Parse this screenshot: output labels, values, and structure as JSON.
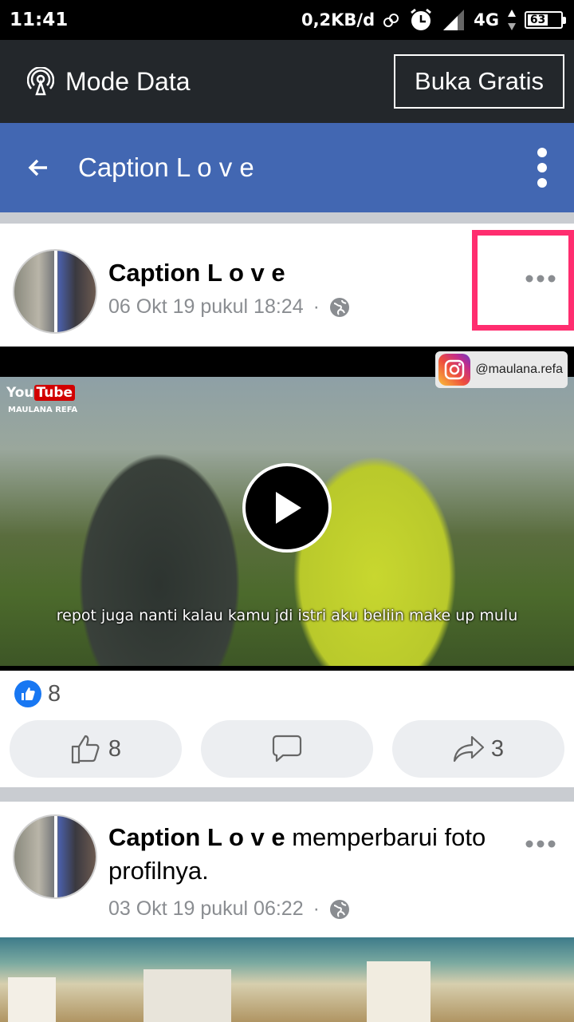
{
  "status_bar": {
    "time": "11:41",
    "data_rate": "0,2KB/d",
    "network": "4G",
    "battery": "63"
  },
  "data_mode": {
    "label": "Mode Data",
    "free_button": "Buka Gratis"
  },
  "header": {
    "title": "Caption L o v e"
  },
  "posts": [
    {
      "author": "Caption L o v e",
      "timestamp": "06 Okt 19 pukul 18:24",
      "separator": "·",
      "video": {
        "youtube_badge_left": "You",
        "youtube_badge_right": "Tube",
        "channel": "MAULANA REFA",
        "instagram_handle": "@maulana.refa",
        "caption": "repot juga nanti kalau kamu jdi istri aku beliin make up mulu"
      },
      "reaction_count": "8",
      "like_count": "8",
      "share_count": "3"
    },
    {
      "author": "Caption L o v e",
      "action_text": " memperbarui foto profilnya.",
      "timestamp": "03 Okt 19 pukul 06:22",
      "separator": "·"
    }
  ],
  "colors": {
    "facebook_blue": "#4267b2",
    "highlight": "#ff2d6f",
    "like_blue": "#1877f2"
  }
}
